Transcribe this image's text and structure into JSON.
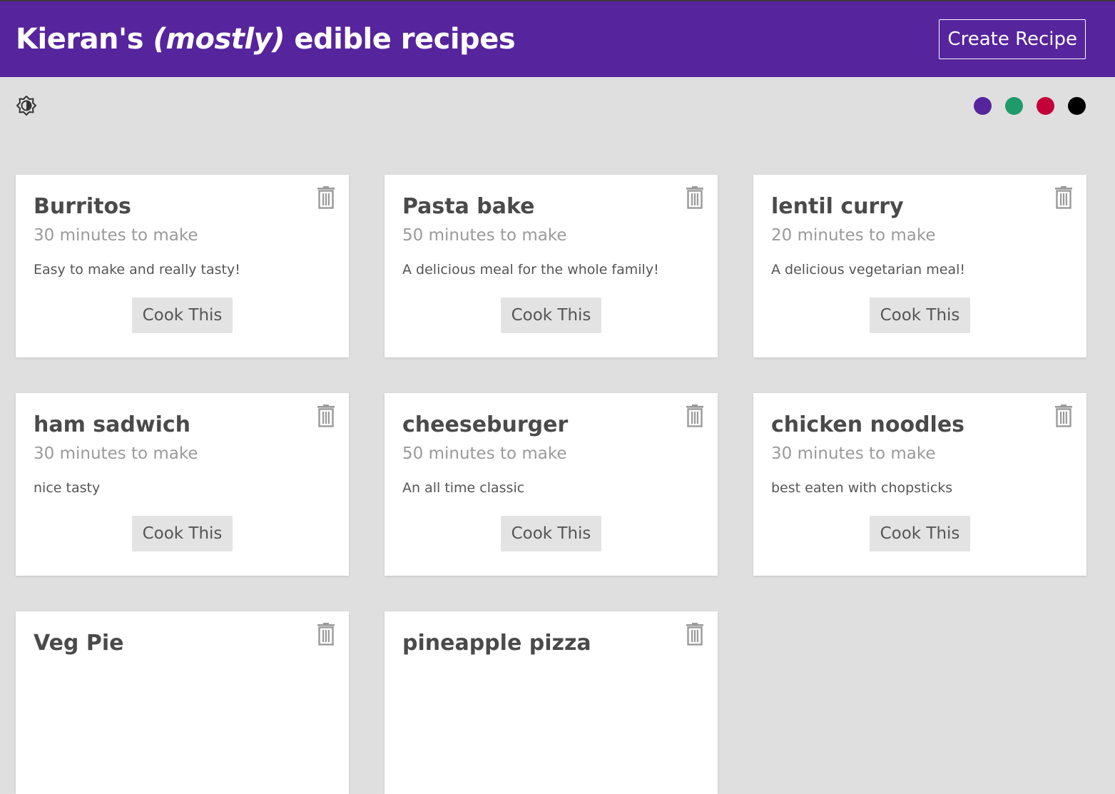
{
  "header": {
    "title_prefix": "Kieran's",
    "title_emphasis": "(mostly)",
    "title_suffix": "edible recipes",
    "create_button_label": "Create Recipe"
  },
  "toolbar": {
    "theme_toggle_icon": "brightness-contrast-icon",
    "theme_swatches": [
      {
        "name": "purple",
        "color": "#56249d"
      },
      {
        "name": "green",
        "color": "#1f9a6a"
      },
      {
        "name": "red",
        "color": "#c4003a"
      },
      {
        "name": "black",
        "color": "#000000"
      }
    ]
  },
  "recipes": [
    {
      "title": "Burritos",
      "time": "30 minutes to make",
      "description": "Easy to make and really tasty!",
      "cook_label": "Cook This"
    },
    {
      "title": "Pasta bake",
      "time": "50 minutes to make",
      "description": "A delicious meal for the whole family!",
      "cook_label": "Cook This"
    },
    {
      "title": "lentil curry",
      "time": "20 minutes to make",
      "description": "A delicious vegetarian meal!",
      "cook_label": "Cook This"
    },
    {
      "title": "ham sadwich",
      "time": "30 minutes to make",
      "description": "nice tasty",
      "cook_label": "Cook This"
    },
    {
      "title": "cheeseburger",
      "time": "50 minutes to make",
      "description": "An all time classic",
      "cook_label": "Cook This"
    },
    {
      "title": "chicken noodles",
      "time": "30 minutes to make",
      "description": "best eaten with chopsticks",
      "cook_label": "Cook This"
    },
    {
      "title": "Veg Pie",
      "time": "",
      "description": "",
      "cook_label": ""
    },
    {
      "title": "pineapple pizza",
      "time": "",
      "description": "",
      "cook_label": ""
    }
  ],
  "colors": {
    "brand": "#56249d",
    "page_background": "#dfdfdf"
  }
}
